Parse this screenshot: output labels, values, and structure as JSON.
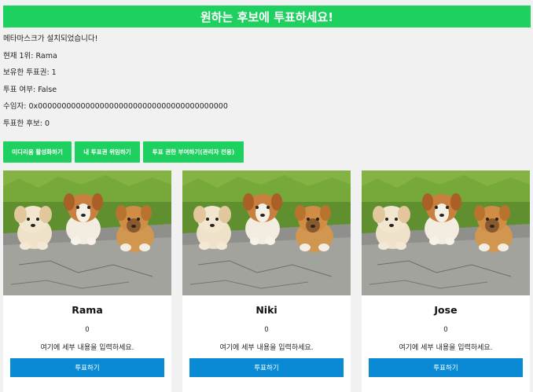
{
  "header": {
    "title": "원하는 후보에 투표하세요!"
  },
  "status": {
    "metamask": "메타마스크가 설치되었습니다!",
    "leader": "현재 1위: Rama",
    "tokens": "보유한 투표권: 1",
    "voted": "투표 여부: False",
    "delegate": "수임자: 0x0000000000000000000000000000000000000000",
    "voted_for": "투표한 후보: 0"
  },
  "actions": {
    "activate": "미디리움 활성화하기",
    "delegate": "내 투표권 위임하기",
    "grant": "투표 권한 부여하기(관리자 전용)"
  },
  "candidates": [
    {
      "name": "Rama",
      "votes": "0",
      "detail": "여기에 세부 내용을 입력하세요.",
      "button": "투표하기"
    },
    {
      "name": "Niki",
      "votes": "0",
      "detail": "여기에 세부 내용을 입력하세요.",
      "button": "투표하기"
    },
    {
      "name": "Jose",
      "votes": "0",
      "detail": "여기에 세부 내용을 입력하세요.",
      "button": "투표하기"
    }
  ],
  "colors": {
    "accent_green": "#1ed05f",
    "vote_blue": "#0a8ad4",
    "background": "#f1f1f1"
  }
}
